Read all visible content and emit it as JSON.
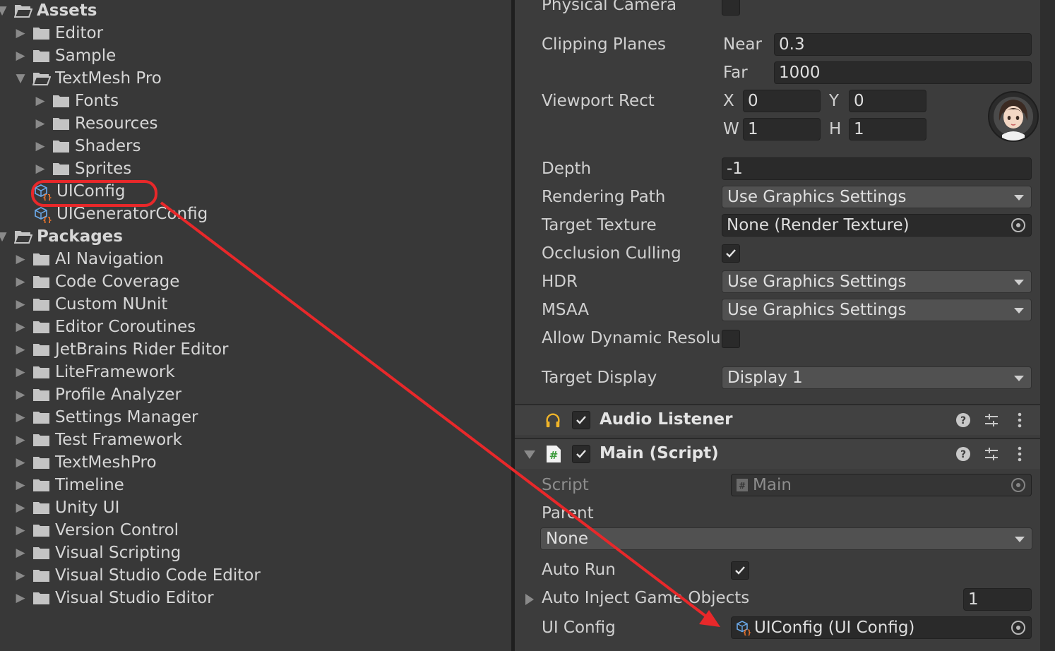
{
  "project": {
    "rows": [
      {
        "label": "Assets",
        "type": "root-open"
      },
      {
        "label": "Editor",
        "type": "folder"
      },
      {
        "label": "Sample",
        "type": "folder"
      },
      {
        "label": "TextMesh Pro",
        "type": "folder-open"
      },
      {
        "label": "Fonts",
        "type": "folder"
      },
      {
        "label": "Resources",
        "type": "folder"
      },
      {
        "label": "Shaders",
        "type": "folder"
      },
      {
        "label": "Sprites",
        "type": "folder"
      },
      {
        "label": "UIConfig",
        "type": "asset"
      },
      {
        "label": "UIGeneratorConfig",
        "type": "asset"
      },
      {
        "label": "Packages",
        "type": "root-open"
      },
      {
        "label": "AI Navigation",
        "type": "folder"
      },
      {
        "label": "Code Coverage",
        "type": "folder"
      },
      {
        "label": "Custom NUnit",
        "type": "folder"
      },
      {
        "label": "Editor Coroutines",
        "type": "folder"
      },
      {
        "label": "JetBrains Rider Editor",
        "type": "folder"
      },
      {
        "label": "LiteFramework",
        "type": "folder"
      },
      {
        "label": "Profile Analyzer",
        "type": "folder"
      },
      {
        "label": "Settings Manager",
        "type": "folder"
      },
      {
        "label": "Test Framework",
        "type": "folder"
      },
      {
        "label": "TextMeshPro",
        "type": "folder"
      },
      {
        "label": "Timeline",
        "type": "folder"
      },
      {
        "label": "Unity UI",
        "type": "folder"
      },
      {
        "label": "Version Control",
        "type": "folder"
      },
      {
        "label": "Visual Scripting",
        "type": "folder"
      },
      {
        "label": "Visual Studio Code Editor",
        "type": "folder"
      },
      {
        "label": "Visual Studio Editor",
        "type": "folder"
      }
    ]
  },
  "camera": {
    "physical_camera_label": "Physical Camera",
    "physical_camera_checked": false,
    "clipping_label": "Clipping Planes",
    "near_label": "Near",
    "near_value": "0.3",
    "far_label": "Far",
    "far_value": "1000",
    "viewport_label": "Viewport Rect",
    "x_label": "X",
    "x_value": "0",
    "y_label": "Y",
    "y_value": "0",
    "w_label": "W",
    "w_value": "1",
    "h_label": "H",
    "h_value": "1",
    "depth_label": "Depth",
    "depth_value": "-1",
    "rendering_path_label": "Rendering Path",
    "rendering_path_value": "Use Graphics Settings",
    "target_texture_label": "Target Texture",
    "target_texture_value": "None (Render Texture)",
    "occlusion_label": "Occlusion Culling",
    "occlusion_checked": true,
    "hdr_label": "HDR",
    "hdr_value": "Use Graphics Settings",
    "msaa_label": "MSAA",
    "msaa_value": "Use Graphics Settings",
    "dynamic_res_label": "Allow Dynamic Resolu",
    "dynamic_res_checked": false,
    "target_display_label": "Target Display",
    "target_display_value": "Display 1"
  },
  "audio_listener": {
    "title": "Audio Listener",
    "enabled": true
  },
  "main_script": {
    "title": "Main (Script)",
    "enabled": true,
    "script_label": "Script",
    "script_value": "Main",
    "parent_label": "Parent",
    "parent_value": "None",
    "auto_run_label": "Auto Run",
    "auto_run_checked": true,
    "auto_inject_label": "Auto Inject Game Objects",
    "auto_inject_value": "1",
    "ui_config_label": "UI Config",
    "ui_config_value": "UIConfig (UI Config)"
  },
  "colors": {
    "annotation_red": "#e8282a",
    "panel_bg": "#383838",
    "inspector_bg": "#3c3c3c",
    "field_bg": "#2a2a2a",
    "dropdown_bg": "#515151",
    "audio_icon": "#f0b429",
    "script_icon": "#3a9a3a"
  }
}
